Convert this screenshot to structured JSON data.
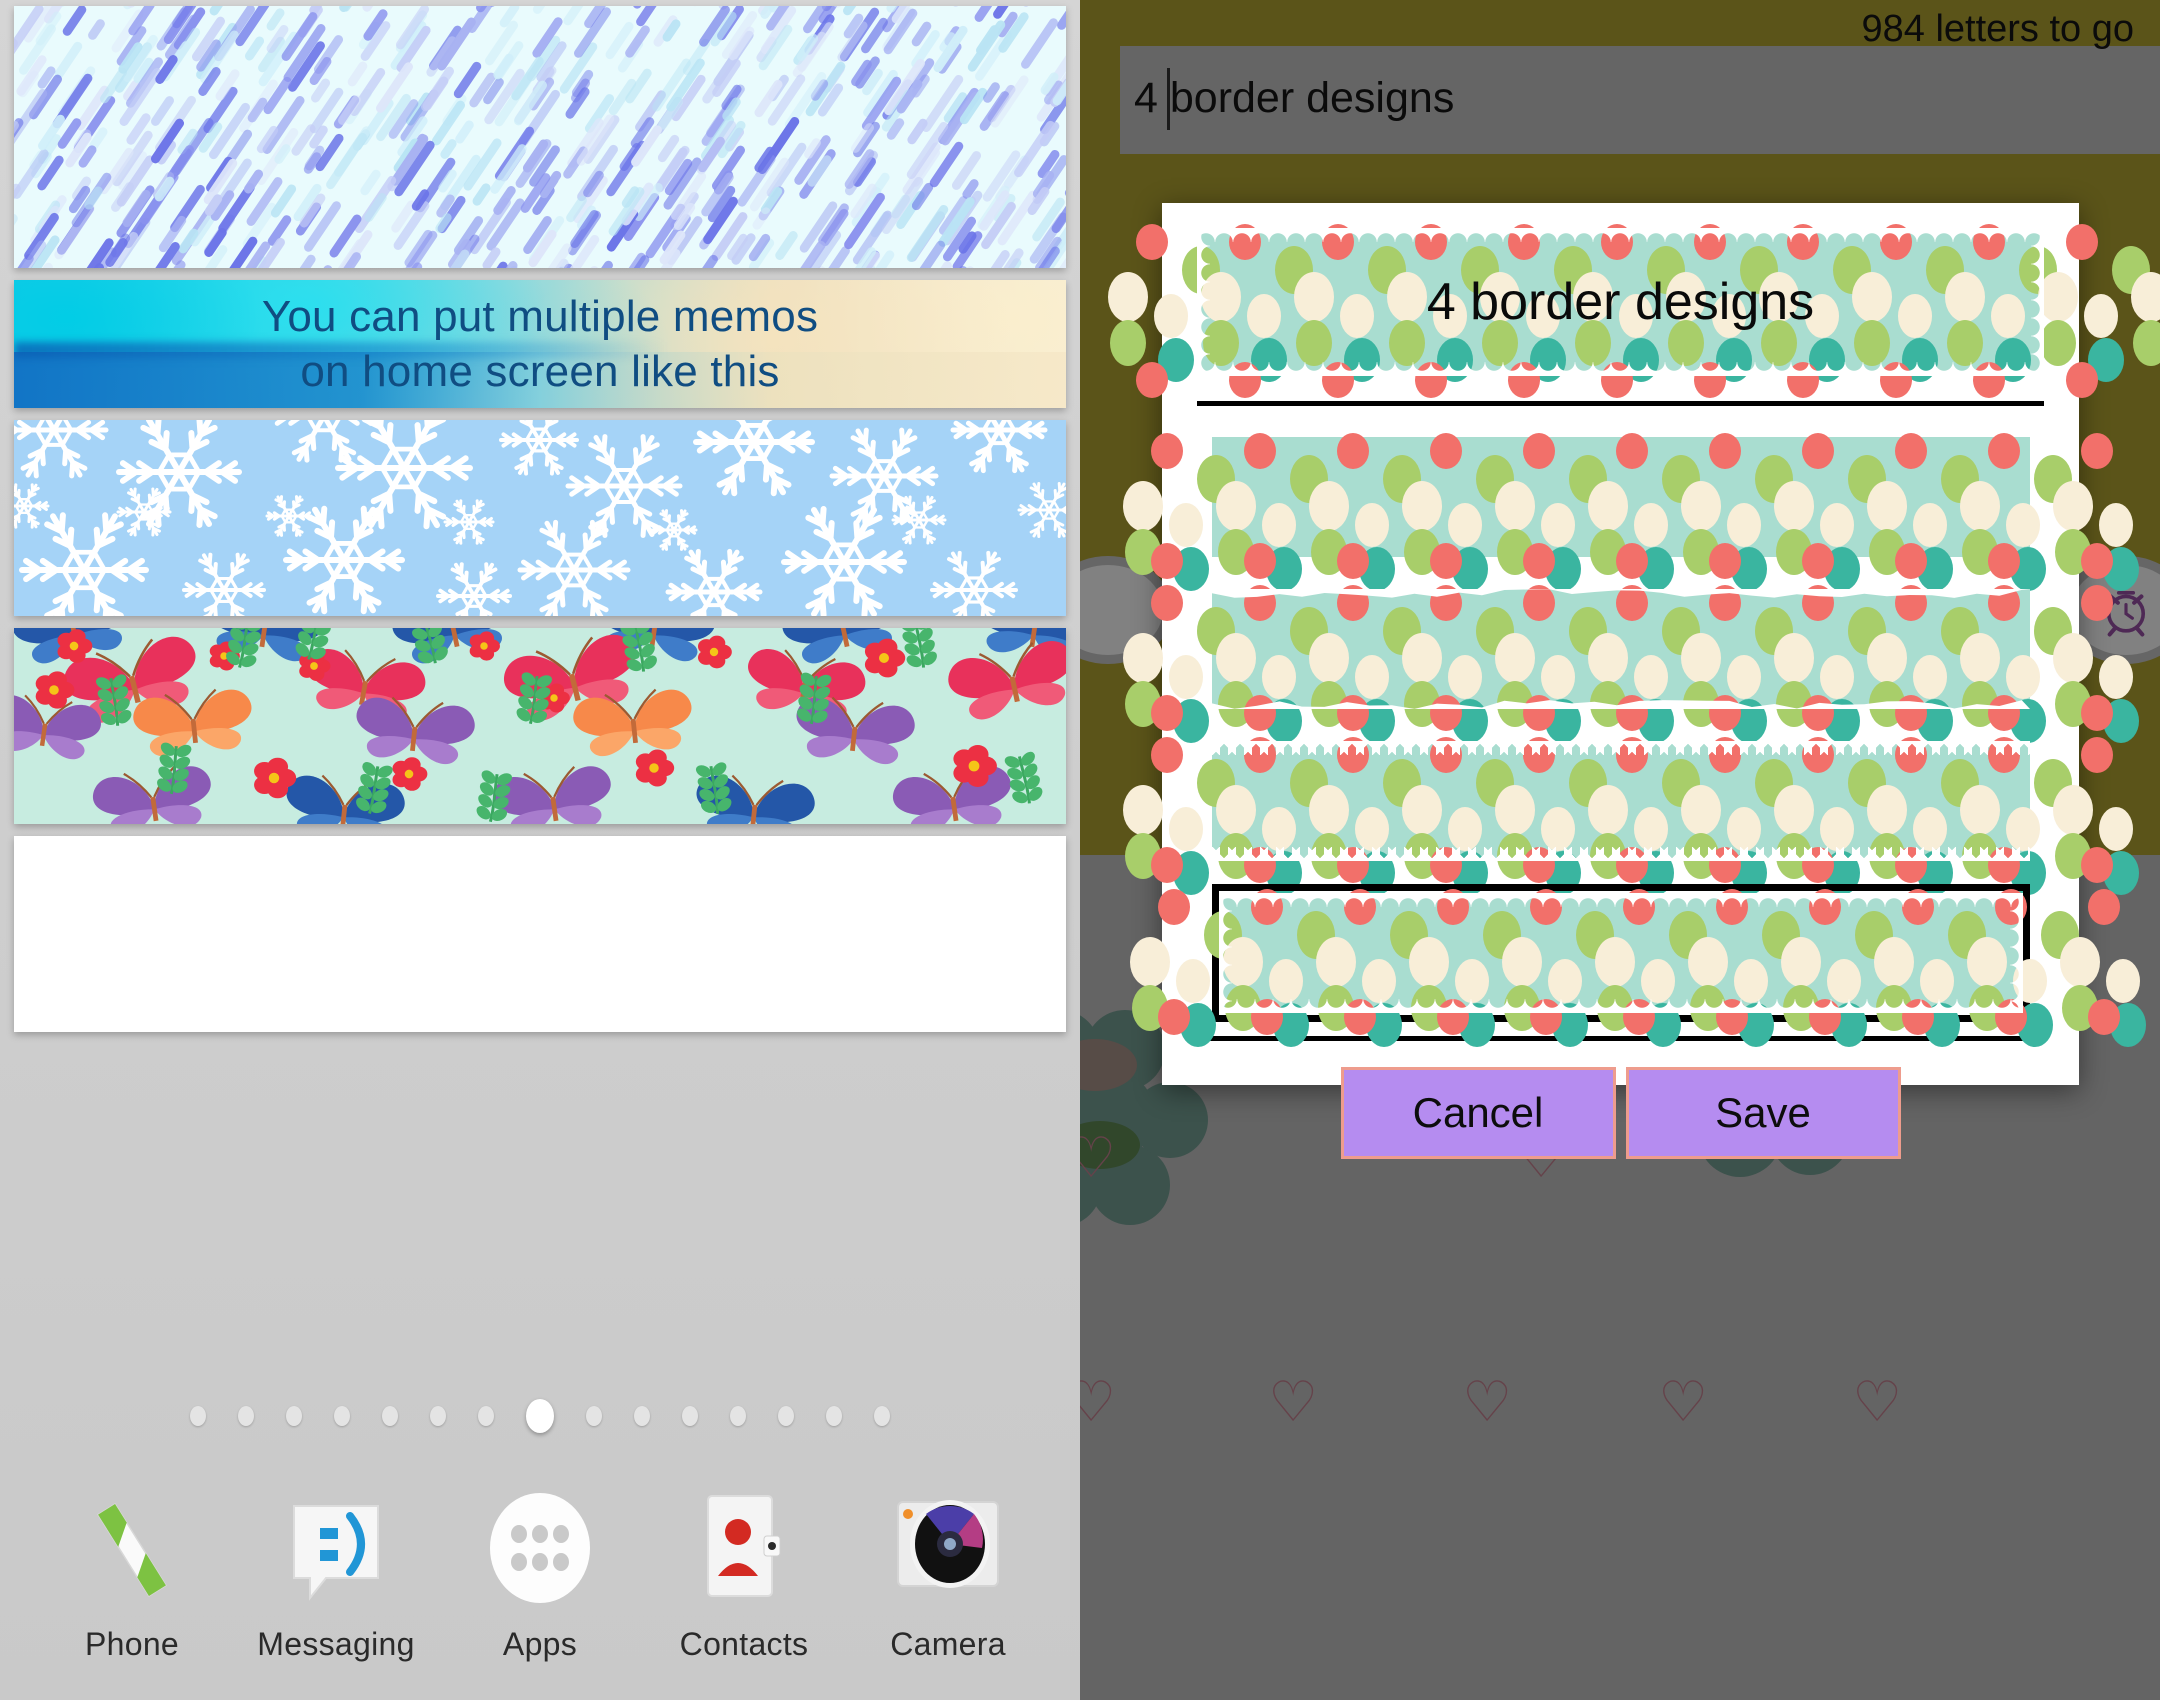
{
  "editor": {
    "letters_counter": "984 letters to go",
    "input_value": "4 border designs",
    "caret_after_chars": 1
  },
  "dialog": {
    "preview_text": "4 border designs",
    "options": [
      {
        "id": "opt-1",
        "edge_style": "straight",
        "selected": false
      },
      {
        "id": "opt-2",
        "edge_style": "torn",
        "selected": false
      },
      {
        "id": "opt-3",
        "edge_style": "zigzag",
        "selected": false
      },
      {
        "id": "opt-4",
        "edge_style": "scallop",
        "selected": true
      }
    ],
    "cancel_label": "Cancel",
    "save_label": "Save"
  },
  "home": {
    "widgets": [
      {
        "name": "rain-memo",
        "label": ""
      },
      {
        "name": "beach-memo",
        "label": "You can put multiple memos\non home screen like this",
        "line1": "You can put multiple memos",
        "line2": "on home screen like this"
      },
      {
        "name": "snowflake-memo",
        "label": ""
      },
      {
        "name": "butterfly-memo",
        "label": ""
      },
      {
        "name": "blue-leaf-memo",
        "label": ""
      }
    ],
    "page_dots": {
      "count": 15,
      "active_index": 7
    },
    "dock": [
      {
        "icon": "phone-icon",
        "label": "Phone"
      },
      {
        "icon": "messaging-icon",
        "label": "Messaging"
      },
      {
        "icon": "apps-grid-icon",
        "label": "Apps"
      },
      {
        "icon": "contacts-icon",
        "label": "Contacts"
      },
      {
        "icon": "camera-icon",
        "label": "Camera"
      }
    ]
  },
  "colors": {
    "tape_bg": "#a9ddd0",
    "dot_cream": "#f8eed8",
    "dot_green": "#a8ce6a",
    "dot_teal": "#3ab5a0",
    "dot_coral": "#f2706a",
    "button_purple": "#b58cf0",
    "button_border": "#ee9c8d",
    "olive_bg": "#7e7317",
    "memo_text": "#104d82",
    "snow_bg": "#a5d3f7",
    "butterfly_bg": "#c7ece0"
  }
}
